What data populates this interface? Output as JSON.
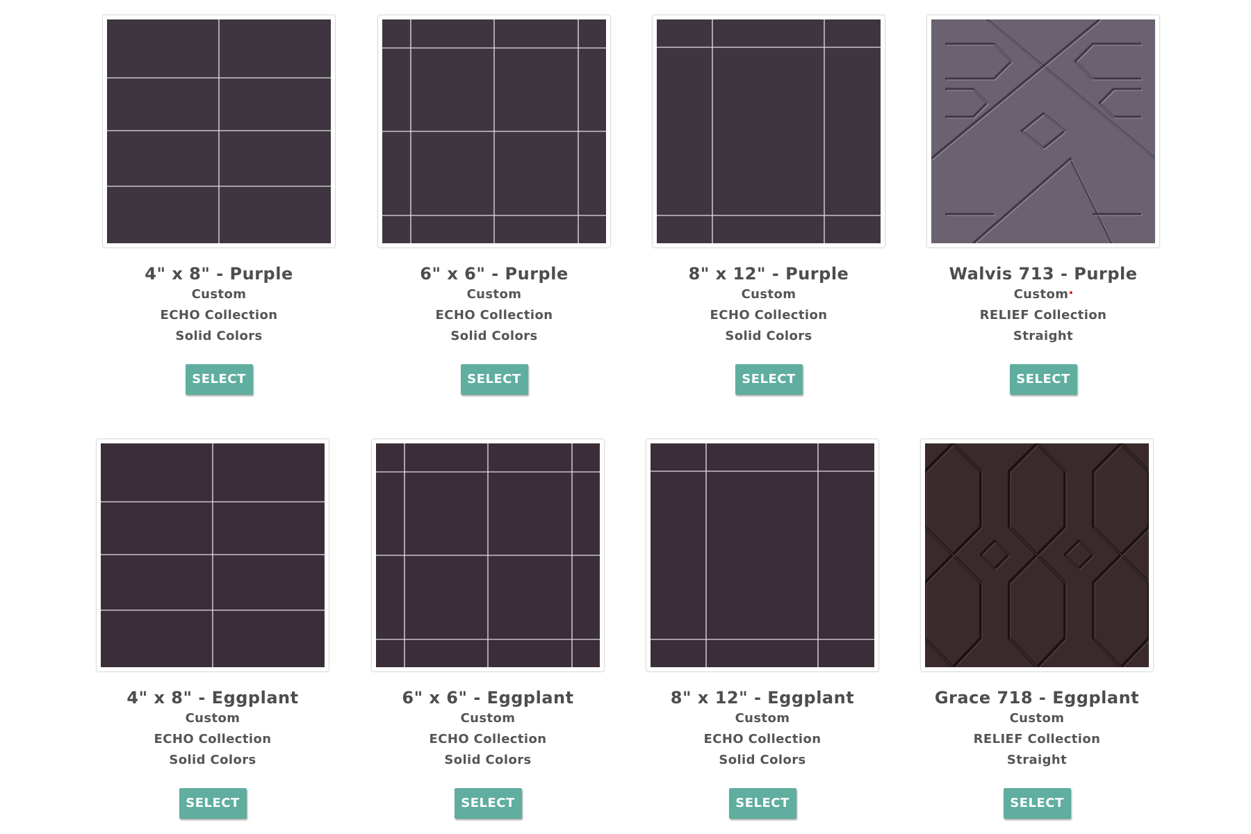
{
  "products": [
    {
      "title": "4\" x 8\" - Purple",
      "type": "Custom",
      "collection": "ECHO Collection",
      "style": "Solid Colors",
      "button": "SELECT",
      "pattern": "grid-4x8",
      "color": "#3f3540",
      "required_mark": false
    },
    {
      "title": "6\" x 6\" - Purple",
      "type": "Custom",
      "collection": "ECHO Collection",
      "style": "Solid Colors",
      "button": "SELECT",
      "pattern": "grid-6x6",
      "color": "#3f3540",
      "required_mark": false
    },
    {
      "title": "8\" x 12\" - Purple",
      "type": "Custom",
      "collection": "ECHO Collection",
      "style": "Solid Colors",
      "button": "SELECT",
      "pattern": "grid-8x12",
      "color": "#3f3540",
      "required_mark": false
    },
    {
      "title": "Walvis 713 - Purple",
      "type": "Custom",
      "collection": "RELIEF Collection",
      "style": "Straight",
      "button": "SELECT",
      "pattern": "relief-walvis",
      "color": "#6a6171",
      "required_mark": true
    },
    {
      "title": "4\" x 8\" - Eggplant",
      "type": "Custom",
      "collection": "ECHO Collection",
      "style": "Solid Colors",
      "button": "SELECT",
      "pattern": "grid-4x8",
      "color": "#3b2e38",
      "required_mark": false
    },
    {
      "title": "6\" x 6\" - Eggplant",
      "type": "Custom",
      "collection": "ECHO Collection",
      "style": "Solid Colors",
      "button": "SELECT",
      "pattern": "grid-6x6",
      "color": "#3b2e38",
      "required_mark": false
    },
    {
      "title": "8\" x 12\" - Eggplant",
      "type": "Custom",
      "collection": "ECHO Collection",
      "style": "Solid Colors",
      "button": "SELECT",
      "pattern": "grid-8x12",
      "color": "#3b2e38",
      "required_mark": false
    },
    {
      "title": "Grace 718 - Eggplant",
      "type": "Custom",
      "collection": "RELIEF Collection",
      "style": "Straight",
      "button": "SELECT",
      "pattern": "relief-grace",
      "color": "#3a2a2b",
      "required_mark": false
    }
  ],
  "colors": {
    "button_bg": "#5fae9f",
    "text": "#4d4d4d",
    "required_mark": "#d0202a"
  }
}
